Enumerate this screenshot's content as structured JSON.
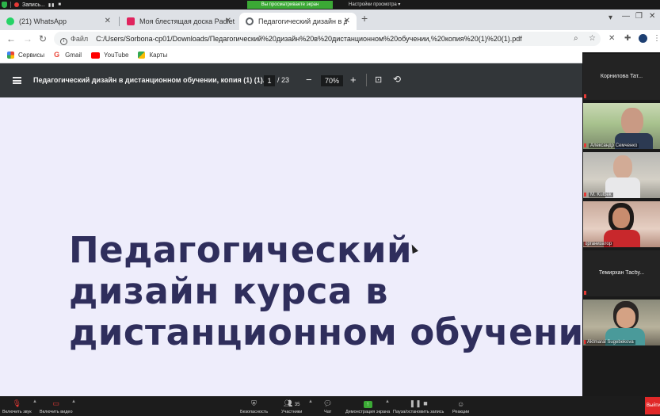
{
  "zoom_top": {
    "recording_label": "Запись...",
    "sharing_banner": "Вы просматриваете экран организатор",
    "view_settings": "Настройки просмотра"
  },
  "tabs": [
    {
      "title": "(21) WhatsApp",
      "favicon_color": "#25d366"
    },
    {
      "title": "Моя блестящая доска Padlet",
      "favicon_color": "#e0245e"
    },
    {
      "title": "Педагогический дизайн в диста",
      "favicon_color": "#5f6368"
    }
  ],
  "address": {
    "file_label": "Файл",
    "url": "C:/Users/Sorbona-cp01/Downloads/Педагогический%20дизайн%20в%20дистанционном%20обучении,%20копия%20(1)%20(1).pdf"
  },
  "bookmarks": [
    {
      "label": "Сервисы",
      "color": "#4285f4"
    },
    {
      "label": "Gmail",
      "color": "#ea4335"
    },
    {
      "label": "YouTube",
      "color": "#ff0000"
    },
    {
      "label": "Карты",
      "color": "#34a853"
    }
  ],
  "pdf": {
    "title": "Педагогический дизайн в дистанционном обучении, копия (1) (1)....",
    "current_page": "1",
    "total_pages": "/ 23",
    "zoom": "70%",
    "heading_lines": [
      "Педагогический",
      "дизайн курса в",
      "дистанционном обучении"
    ],
    "heading_color": "#2f2e5c",
    "page_bg": "#eeedfb"
  },
  "participants": [
    {
      "name": "Корнилова  Тат...",
      "video": false
    },
    {
      "name": "Александр Семченко",
      "video": true
    },
    {
      "name": "M. Kulbek",
      "video": true
    },
    {
      "name": "организатор",
      "video": true
    },
    {
      "name": "Темирхан  Тасбу...",
      "video": false
    },
    {
      "name": "Aktmaral Sugebekova",
      "video": true
    }
  ],
  "toolbar": {
    "mute": "Включить звук",
    "video": "Включить видео",
    "security": "Безопасность",
    "participants": "Участники",
    "participants_count": "35",
    "chat": "Чат",
    "share": "Демонстрация экрана",
    "record": "Пауза/остановить запись",
    "reactions": "Реакции",
    "exit": "Выйти"
  }
}
